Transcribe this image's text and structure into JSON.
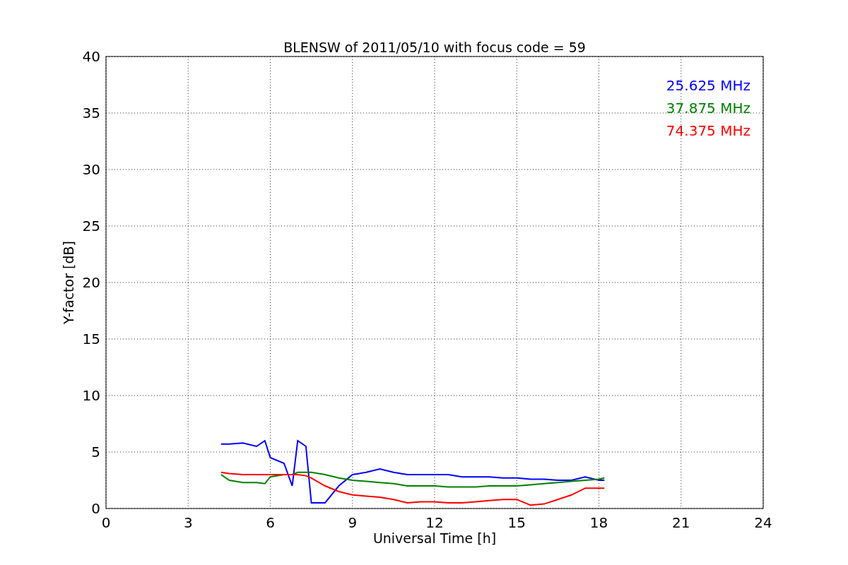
{
  "chart_data": {
    "type": "line",
    "title": "BLENSW of 2011/05/10 with focus code = 59",
    "xlabel": "Universal Time [h]",
    "ylabel": "Y-factor [dB]",
    "x": [
      4.2,
      4.5,
      5,
      5.5,
      5.8,
      6,
      6.5,
      6.8,
      7,
      7.3,
      7.5,
      8,
      8.5,
      9,
      9.5,
      10,
      10.5,
      11,
      11.5,
      12,
      12.5,
      13,
      13.5,
      14,
      14.5,
      15,
      15.5,
      16,
      16.5,
      17,
      17.5,
      18,
      18.2
    ],
    "series": [
      {
        "name": "25.625 MHz",
        "color": "#0000ff",
        "values": [
          5.7,
          5.7,
          5.8,
          5.5,
          6,
          4.5,
          4,
          2,
          6,
          5.5,
          0.5,
          0.5,
          2,
          3,
          3.2,
          3.5,
          3.2,
          3,
          3,
          3,
          3,
          2.8,
          2.8,
          2.8,
          2.7,
          2.7,
          2.6,
          2.6,
          2.5,
          2.5,
          2.8,
          2.5,
          2.5
        ]
      },
      {
        "name": "37.875 MHz",
        "color": "#008000",
        "values": [
          3,
          2.5,
          2.3,
          2.3,
          2.2,
          2.8,
          3,
          3,
          3.2,
          3.2,
          3.2,
          3,
          2.7,
          2.5,
          2.4,
          2.3,
          2.2,
          2,
          2,
          2,
          1.9,
          1.9,
          1.9,
          2,
          2,
          2,
          2.1,
          2.2,
          2.3,
          2.4,
          2.5,
          2.6,
          2.7
        ]
      },
      {
        "name": "74.375 MHz",
        "color": "#ff0000",
        "values": [
          3.2,
          3.1,
          3,
          3,
          3,
          3,
          3,
          3,
          3,
          2.9,
          2.7,
          2,
          1.5,
          1.2,
          1.1,
          1,
          0.8,
          0.5,
          0.6,
          0.6,
          0.5,
          0.5,
          0.6,
          0.7,
          0.8,
          0.8,
          0.3,
          0.4,
          0.8,
          1.2,
          1.8,
          1.8,
          1.8
        ]
      }
    ],
    "xlim": [
      0,
      24
    ],
    "ylim": [
      0,
      40
    ],
    "xticks": [
      0,
      3,
      6,
      9,
      12,
      15,
      18,
      21,
      24
    ],
    "yticks": [
      0,
      5,
      10,
      15,
      20,
      25,
      30,
      35,
      40
    ],
    "grid": true
  }
}
